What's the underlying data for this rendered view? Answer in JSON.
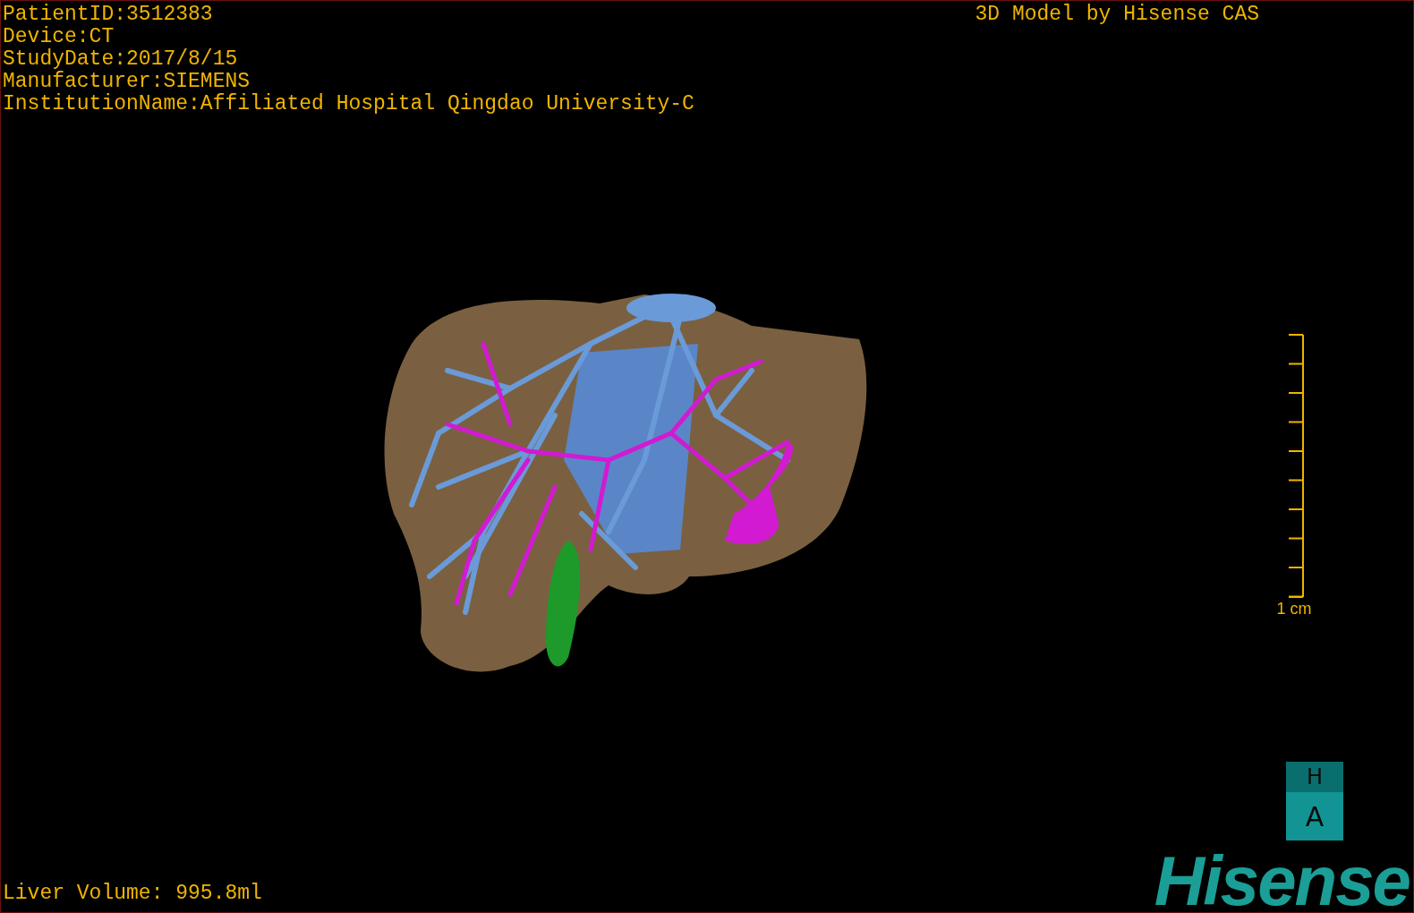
{
  "info_lines": [
    "PatientID:3512383",
    "Device:CT",
    "StudyDate:2017/8/15",
    "Manufacturer:SIEMENS",
    "InstitutionName:Affiliated Hospital Qingdao University-C"
  ],
  "title": "3D Model by Hisense CAS",
  "scale_bar": {
    "label": "1 cm"
  },
  "orientation_cube": {
    "top": "H",
    "front": "A"
  },
  "liver_volume": "Liver Volume: 995.8ml",
  "logo": "Hisense"
}
